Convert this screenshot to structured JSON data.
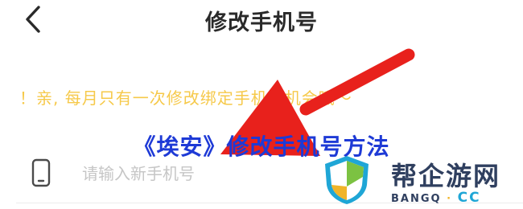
{
  "header": {
    "title": "修改手机号",
    "back_icon": "chevron-left-icon"
  },
  "notice": "！亲, 每月只有一次修改绑定手机号机会哦～",
  "overlay_title": "《埃安》修改手机号方法",
  "phone_field": {
    "icon": "mobile-phone-icon",
    "placeholder": "请输入新手机号",
    "value": ""
  },
  "watermark": {
    "name": "帮企游网",
    "sub_left": "BANGQ",
    "sub_dot": "·",
    "sub_right": "CC"
  },
  "colors": {
    "notice": "#f6c94a",
    "overlay_title": "#1e3ad6",
    "arrow": "#e8211c",
    "logo_text": "#2f3f5f",
    "logo_accent": "#1fa6d6"
  }
}
